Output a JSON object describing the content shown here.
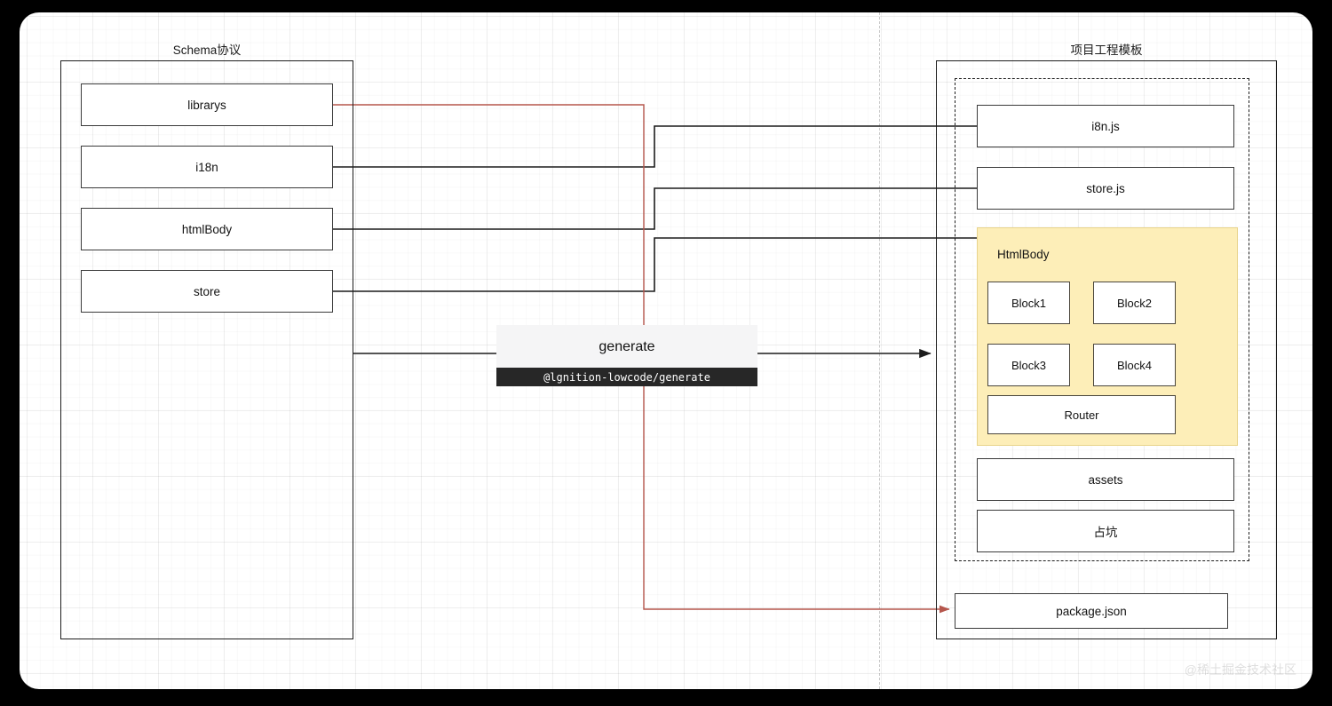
{
  "diagram": {
    "watermark": "@稀土掘金技术社区",
    "left_panel": {
      "title": "Schema协议",
      "nodes": [
        {
          "label": "librarys"
        },
        {
          "label": "i18n"
        },
        {
          "label": "htmlBody"
        },
        {
          "label": "store"
        }
      ]
    },
    "center": {
      "title": "generate",
      "package": "@lgnition-lowcode/generate"
    },
    "right_panel": {
      "title": "项目工程模板",
      "nodes": [
        {
          "label": "i8n.js"
        },
        {
          "label": "store.js"
        }
      ],
      "html_body": {
        "label": "HtmlBody",
        "blocks": [
          {
            "label": "Block1"
          },
          {
            "label": "Block2"
          },
          {
            "label": "Block3"
          },
          {
            "label": "Block4"
          }
        ],
        "router": "Router"
      },
      "tail_nodes": [
        {
          "label": "assets"
        },
        {
          "label": "占坑"
        }
      ],
      "external": {
        "label": "package.json"
      }
    },
    "colors": {
      "accent_red": "#b5564c",
      "connector_black": "#1c1c1c",
      "html_body_fill": "#fdeeb8",
      "code_bar": "#272727"
    }
  }
}
